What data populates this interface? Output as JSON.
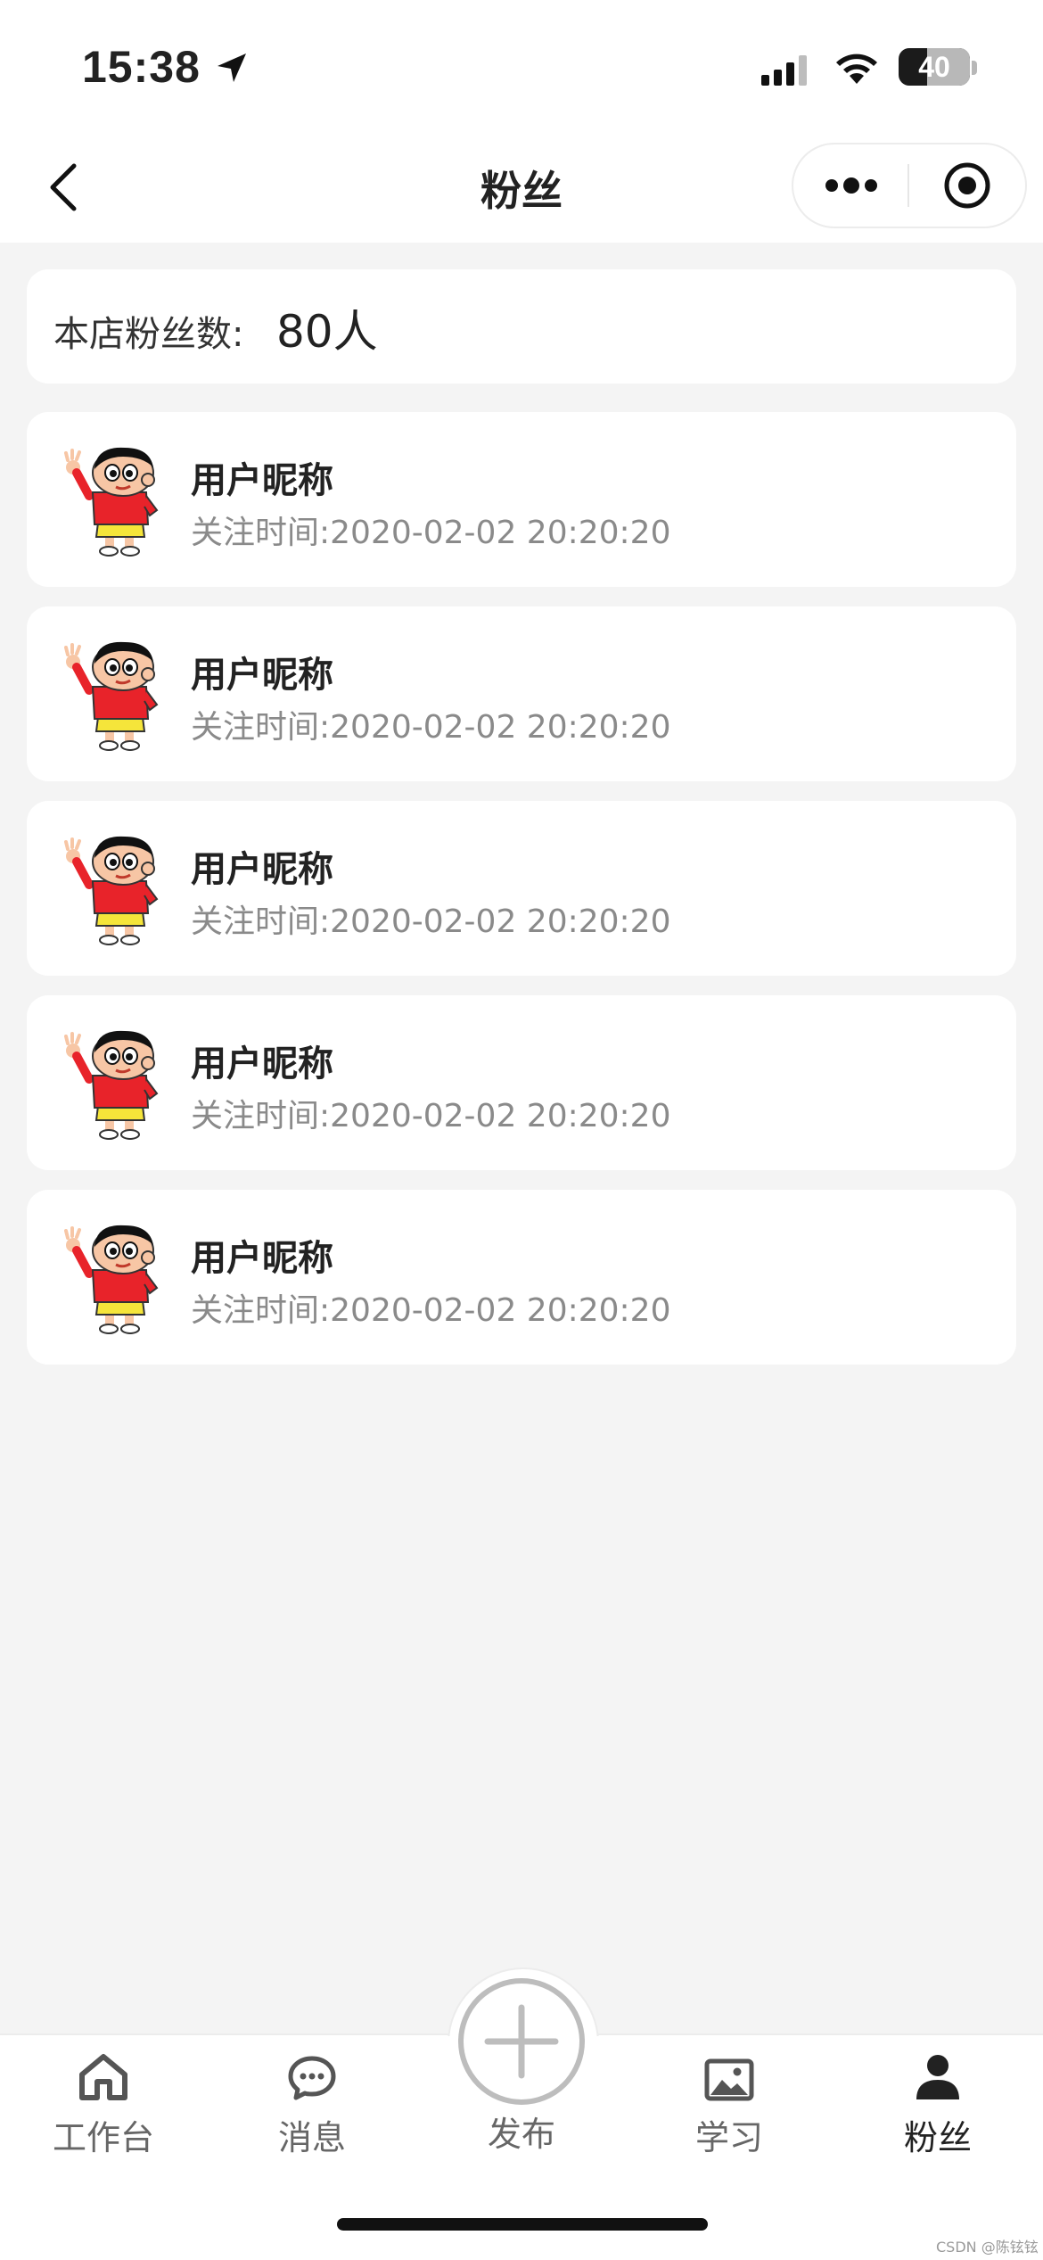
{
  "status_bar": {
    "time": "15:38",
    "battery": "40",
    "battery_level": 0.4
  },
  "nav": {
    "title": "粉丝"
  },
  "fan_count": {
    "label": "本店粉丝数:",
    "value": "80人"
  },
  "fans": [
    {
      "name": "用户昵称",
      "time": "关注时间:2020-02-02 20:20:20"
    },
    {
      "name": "用户昵称",
      "time": "关注时间:2020-02-02 20:20:20"
    },
    {
      "name": "用户昵称",
      "time": "关注时间:2020-02-02 20:20:20"
    },
    {
      "name": "用户昵称",
      "time": "关注时间:2020-02-02 20:20:20"
    },
    {
      "name": "用户昵称",
      "time": "关注时间:2020-02-02 20:20:20"
    }
  ],
  "tabbar": {
    "items": [
      {
        "label": "工作台",
        "icon": "home-icon"
      },
      {
        "label": "消息",
        "icon": "chat-icon"
      },
      {
        "label": "发布",
        "icon": "plus-icon"
      },
      {
        "label": "学习",
        "icon": "image-icon"
      },
      {
        "label": "粉丝",
        "icon": "person-icon",
        "active": true
      }
    ]
  },
  "watermark": "CSDN @陈铉铉",
  "colors": {
    "active": "#222222",
    "inactive": "#666666",
    "publish_ring": "#bdbdbd",
    "background": "#f4f4f4"
  }
}
